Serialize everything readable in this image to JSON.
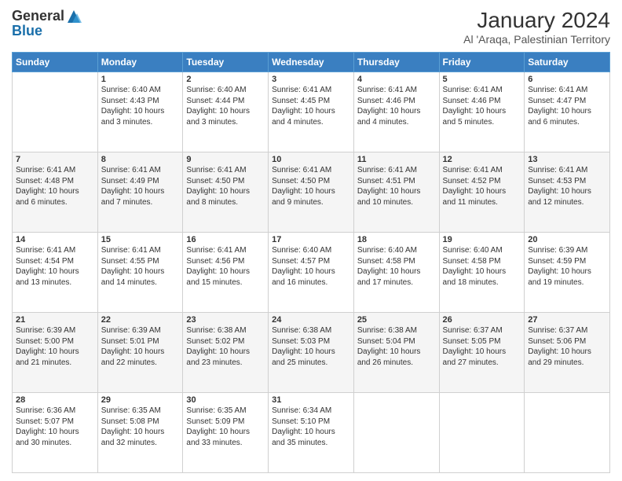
{
  "header": {
    "logo_line1": "General",
    "logo_line2": "Blue",
    "main_title": "January 2024",
    "subtitle": "Al 'Araqa, Palestinian Territory"
  },
  "days_of_week": [
    "Sunday",
    "Monday",
    "Tuesday",
    "Wednesday",
    "Thursday",
    "Friday",
    "Saturday"
  ],
  "weeks": [
    [
      {
        "day": "",
        "info": ""
      },
      {
        "day": "1",
        "info": "Sunrise: 6:40 AM\nSunset: 4:43 PM\nDaylight: 10 hours\nand 3 minutes."
      },
      {
        "day": "2",
        "info": "Sunrise: 6:40 AM\nSunset: 4:44 PM\nDaylight: 10 hours\nand 3 minutes."
      },
      {
        "day": "3",
        "info": "Sunrise: 6:41 AM\nSunset: 4:45 PM\nDaylight: 10 hours\nand 4 minutes."
      },
      {
        "day": "4",
        "info": "Sunrise: 6:41 AM\nSunset: 4:46 PM\nDaylight: 10 hours\nand 4 minutes."
      },
      {
        "day": "5",
        "info": "Sunrise: 6:41 AM\nSunset: 4:46 PM\nDaylight: 10 hours\nand 5 minutes."
      },
      {
        "day": "6",
        "info": "Sunrise: 6:41 AM\nSunset: 4:47 PM\nDaylight: 10 hours\nand 6 minutes."
      }
    ],
    [
      {
        "day": "7",
        "info": "Sunrise: 6:41 AM\nSunset: 4:48 PM\nDaylight: 10 hours\nand 6 minutes."
      },
      {
        "day": "8",
        "info": "Sunrise: 6:41 AM\nSunset: 4:49 PM\nDaylight: 10 hours\nand 7 minutes."
      },
      {
        "day": "9",
        "info": "Sunrise: 6:41 AM\nSunset: 4:50 PM\nDaylight: 10 hours\nand 8 minutes."
      },
      {
        "day": "10",
        "info": "Sunrise: 6:41 AM\nSunset: 4:50 PM\nDaylight: 10 hours\nand 9 minutes."
      },
      {
        "day": "11",
        "info": "Sunrise: 6:41 AM\nSunset: 4:51 PM\nDaylight: 10 hours\nand 10 minutes."
      },
      {
        "day": "12",
        "info": "Sunrise: 6:41 AM\nSunset: 4:52 PM\nDaylight: 10 hours\nand 11 minutes."
      },
      {
        "day": "13",
        "info": "Sunrise: 6:41 AM\nSunset: 4:53 PM\nDaylight: 10 hours\nand 12 minutes."
      }
    ],
    [
      {
        "day": "14",
        "info": "Sunrise: 6:41 AM\nSunset: 4:54 PM\nDaylight: 10 hours\nand 13 minutes."
      },
      {
        "day": "15",
        "info": "Sunrise: 6:41 AM\nSunset: 4:55 PM\nDaylight: 10 hours\nand 14 minutes."
      },
      {
        "day": "16",
        "info": "Sunrise: 6:41 AM\nSunset: 4:56 PM\nDaylight: 10 hours\nand 15 minutes."
      },
      {
        "day": "17",
        "info": "Sunrise: 6:40 AM\nSunset: 4:57 PM\nDaylight: 10 hours\nand 16 minutes."
      },
      {
        "day": "18",
        "info": "Sunrise: 6:40 AM\nSunset: 4:58 PM\nDaylight: 10 hours\nand 17 minutes."
      },
      {
        "day": "19",
        "info": "Sunrise: 6:40 AM\nSunset: 4:58 PM\nDaylight: 10 hours\nand 18 minutes."
      },
      {
        "day": "20",
        "info": "Sunrise: 6:39 AM\nSunset: 4:59 PM\nDaylight: 10 hours\nand 19 minutes."
      }
    ],
    [
      {
        "day": "21",
        "info": "Sunrise: 6:39 AM\nSunset: 5:00 PM\nDaylight: 10 hours\nand 21 minutes."
      },
      {
        "day": "22",
        "info": "Sunrise: 6:39 AM\nSunset: 5:01 PM\nDaylight: 10 hours\nand 22 minutes."
      },
      {
        "day": "23",
        "info": "Sunrise: 6:38 AM\nSunset: 5:02 PM\nDaylight: 10 hours\nand 23 minutes."
      },
      {
        "day": "24",
        "info": "Sunrise: 6:38 AM\nSunset: 5:03 PM\nDaylight: 10 hours\nand 25 minutes."
      },
      {
        "day": "25",
        "info": "Sunrise: 6:38 AM\nSunset: 5:04 PM\nDaylight: 10 hours\nand 26 minutes."
      },
      {
        "day": "26",
        "info": "Sunrise: 6:37 AM\nSunset: 5:05 PM\nDaylight: 10 hours\nand 27 minutes."
      },
      {
        "day": "27",
        "info": "Sunrise: 6:37 AM\nSunset: 5:06 PM\nDaylight: 10 hours\nand 29 minutes."
      }
    ],
    [
      {
        "day": "28",
        "info": "Sunrise: 6:36 AM\nSunset: 5:07 PM\nDaylight: 10 hours\nand 30 minutes."
      },
      {
        "day": "29",
        "info": "Sunrise: 6:35 AM\nSunset: 5:08 PM\nDaylight: 10 hours\nand 32 minutes."
      },
      {
        "day": "30",
        "info": "Sunrise: 6:35 AM\nSunset: 5:09 PM\nDaylight: 10 hours\nand 33 minutes."
      },
      {
        "day": "31",
        "info": "Sunrise: 6:34 AM\nSunset: 5:10 PM\nDaylight: 10 hours\nand 35 minutes."
      },
      {
        "day": "",
        "info": ""
      },
      {
        "day": "",
        "info": ""
      },
      {
        "day": "",
        "info": ""
      }
    ]
  ]
}
